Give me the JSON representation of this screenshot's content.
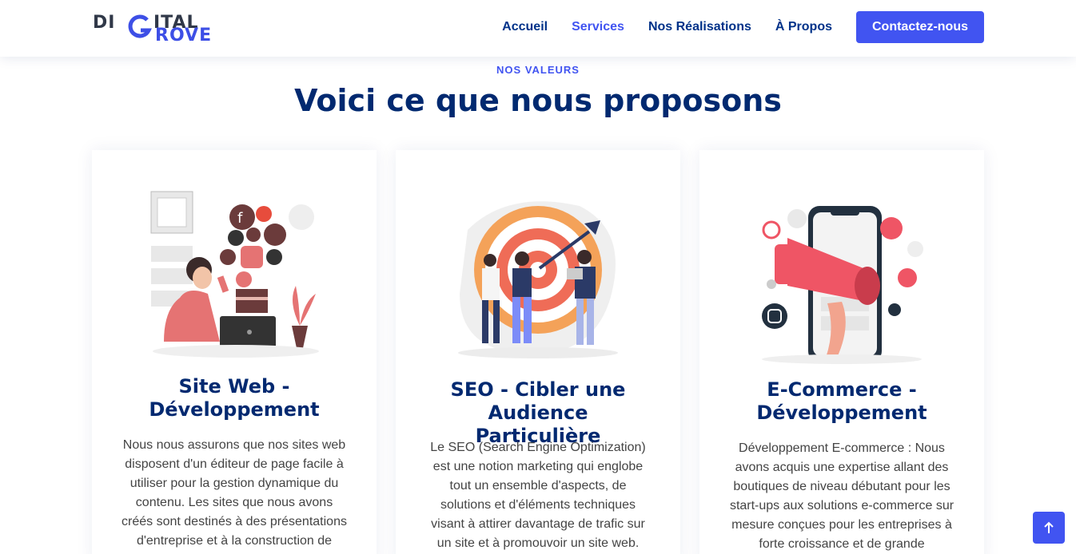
{
  "logo": {
    "part1": "DI",
    "part2": "ITAL",
    "part3": "ROVE"
  },
  "nav": {
    "items": [
      "Accueil",
      "Services",
      "Nos Réalisations",
      "À Propos"
    ],
    "cta": "Contactez-nous"
  },
  "section": {
    "eyebrow": "NOS VALEURS",
    "title": "Voici ce que nous proposons"
  },
  "cards": [
    {
      "title_line1": "Site Web -",
      "title_line2": "Développement",
      "lines": [
        "Nous nous assurons que nos sites web",
        "disposent d'un éditeur de page facile à",
        "utiliser pour la gestion dynamique du",
        "contenu. Les sites que nous avons",
        "créés sont destinés à des présentations",
        "d'entreprise et à la construction de"
      ]
    },
    {
      "title_line1": "SEO - Cibler une Audience",
      "title_line2": "Particulière",
      "lines": [
        "Le SEO (Search Engine Optimization)",
        "est une notion marketing qui englobe",
        "tout un ensemble d'aspects, de",
        "solutions et d'éléments techniques",
        "visant à attirer davantage de trafic sur",
        "un site et à promouvoir un site web."
      ]
    },
    {
      "title_line1": "E-Commerce -",
      "title_line2": "Développement",
      "lines": [
        "Développement E-commerce : Nous",
        "avons acquis une expertise allant des",
        "boutiques de niveau débutant pour les",
        "start-ups aux solutions e-commerce sur",
        "mesure conçues pour les entreprises à",
        "forte croissance et de grande"
      ]
    }
  ],
  "scroll_top_icon": "arrow-up-icon",
  "colors": {
    "primary": "#4154f1",
    "heading": "#012970",
    "nav": "#013289"
  }
}
